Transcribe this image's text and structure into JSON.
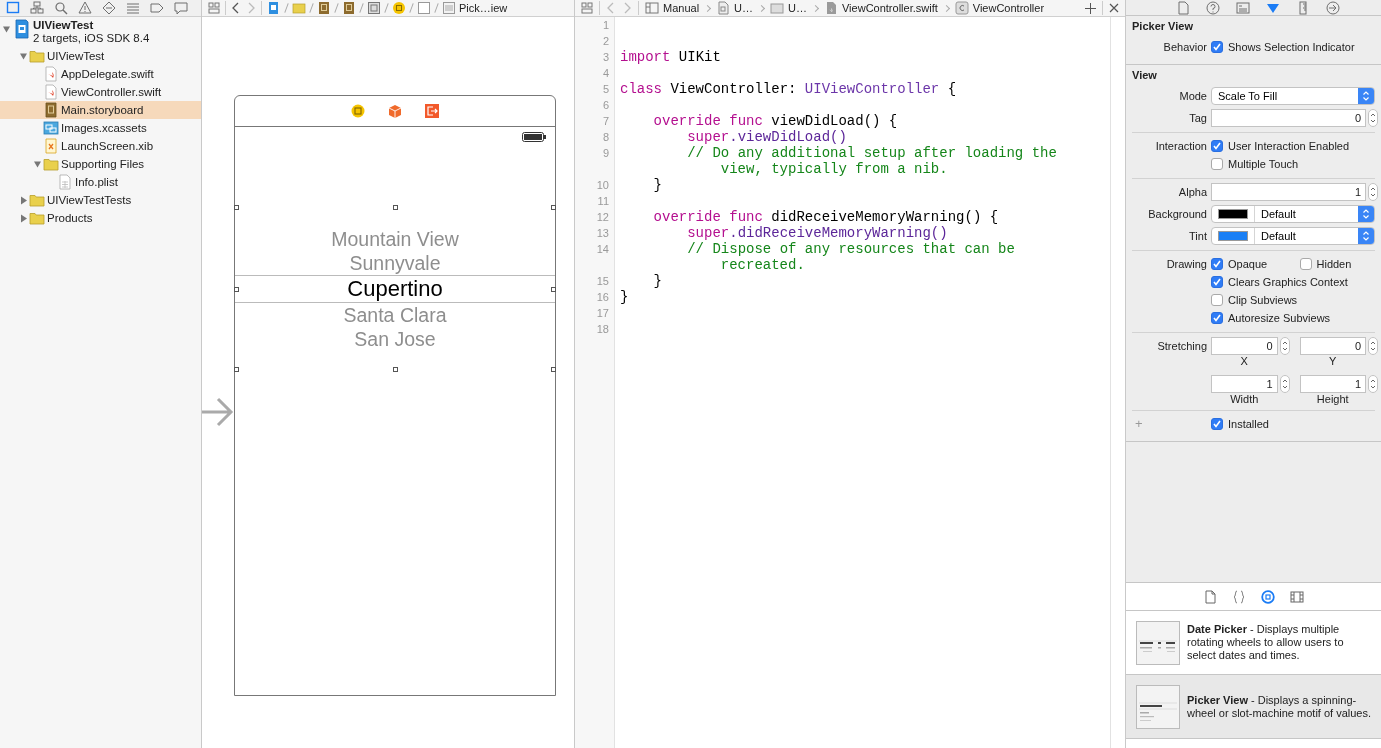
{
  "navigator": {
    "tabs": [
      {
        "kind": "folder",
        "selected": true
      },
      {
        "kind": "hierarchy",
        "selected": false
      },
      {
        "kind": "search",
        "selected": false
      },
      {
        "kind": "warning",
        "selected": false
      },
      {
        "kind": "test",
        "selected": false
      },
      {
        "kind": "debug",
        "selected": false
      },
      {
        "kind": "breakpoint",
        "selected": false
      },
      {
        "kind": "report",
        "selected": false
      }
    ],
    "project": {
      "name": "UIViewTest",
      "subtitle": "2 targets, iOS SDK 8.4",
      "expanded": true,
      "children": [
        {
          "name": "UIViewTest",
          "kind": "folder",
          "expanded": true,
          "selected": false,
          "children": [
            {
              "name": "AppDelegate.swift",
              "kind": "swift",
              "selected": false
            },
            {
              "name": "ViewController.swift",
              "kind": "swift",
              "selected": false
            },
            {
              "name": "Main.storyboard",
              "kind": "storyboard",
              "selected": true
            },
            {
              "name": "Images.xcassets",
              "kind": "assets",
              "selected": false
            },
            {
              "name": "LaunchScreen.xib",
              "kind": "xib",
              "selected": false
            },
            {
              "name": "Supporting Files",
              "kind": "folder",
              "expanded": true,
              "selected": false,
              "children": [
                {
                  "name": "Info.plist",
                  "kind": "plist",
                  "selected": false
                }
              ]
            }
          ]
        },
        {
          "name": "UIViewTestTests",
          "kind": "folder",
          "expanded": false,
          "selected": false
        },
        {
          "name": "Products",
          "kind": "folder",
          "expanded": false,
          "selected": false
        }
      ]
    }
  },
  "canvas": {
    "jump_bar": {
      "crumbs": [
        {
          "kind": "project"
        },
        {
          "kind": "folder"
        },
        {
          "kind": "storyboard"
        },
        {
          "kind": "storyboard"
        },
        {
          "kind": "scene"
        },
        {
          "kind": "controller"
        },
        {
          "kind": "view"
        },
        {
          "kind": "picker",
          "label": "Pick…iew"
        }
      ]
    },
    "scene": {
      "bar_icons": [
        {
          "kind": "controller"
        },
        {
          "kind": "cube"
        },
        {
          "kind": "exit"
        }
      ],
      "picker": {
        "items": [
          {
            "text": "Mountain View",
            "selected": false
          },
          {
            "text": "Sunnyvale",
            "selected": false
          },
          {
            "text": "Cupertino",
            "selected": true
          },
          {
            "text": "Santa Clara",
            "selected": false
          },
          {
            "text": "San Jose",
            "selected": false
          }
        ]
      }
    }
  },
  "editor": {
    "jump_bar": {
      "crumbs": [
        {
          "kind": "related",
          "label": "Manual"
        },
        {
          "kind": "doc",
          "label": "U…"
        },
        {
          "kind": "folder",
          "label": "U…"
        },
        {
          "kind": "swift",
          "label": "ViewController.swift"
        },
        {
          "kind": "class",
          "label": "ViewController"
        }
      ]
    },
    "lines": [
      {
        "number": "1"
      },
      {
        "number": "2"
      },
      {
        "number": "3",
        "tokens": [
          {
            "kind": "keyword",
            "text": "import"
          },
          {
            "kind": "plain",
            "text": " UIKit"
          }
        ]
      },
      {
        "number": "4"
      },
      {
        "number": "5",
        "tokens": [
          {
            "kind": "keyword",
            "text": "class"
          },
          {
            "kind": "plain",
            "text": " ViewController: "
          },
          {
            "kind": "type",
            "text": "UIViewController"
          },
          {
            "kind": "plain",
            "text": " {"
          }
        ]
      },
      {
        "number": "6"
      },
      {
        "number": "7",
        "tokens": [
          {
            "kind": "keyword",
            "text": "    override"
          },
          {
            "kind": "keyword",
            "text": " func"
          },
          {
            "kind": "plain",
            "text": " viewDidLoad() {"
          }
        ]
      },
      {
        "number": "8",
        "tokens": [
          {
            "kind": "keyword",
            "text": "        super"
          },
          {
            "kind": "method",
            "text": ".viewDidLoad()"
          }
        ]
      },
      {
        "number": "9",
        "tokens": [
          {
            "kind": "comment",
            "text": "        // Do any additional setup after loading the view, typically from a nib."
          }
        ]
      },
      {
        "number": "10",
        "tokens": [
          {
            "kind": "plain",
            "text": "    }"
          }
        ]
      },
      {
        "number": "11"
      },
      {
        "number": "12",
        "tokens": [
          {
            "kind": "keyword",
            "text": "    override"
          },
          {
            "kind": "keyword",
            "text": " func"
          },
          {
            "kind": "plain",
            "text": " didReceiveMemoryWarning() {"
          }
        ]
      },
      {
        "number": "13",
        "tokens": [
          {
            "kind": "keyword",
            "text": "        super"
          },
          {
            "kind": "method",
            "text": ".didReceiveMemoryWarning()"
          }
        ]
      },
      {
        "number": "14",
        "tokens": [
          {
            "kind": "comment",
            "text": "        // Dispose of any resources that can be recreated."
          }
        ]
      },
      {
        "number": "15",
        "tokens": [
          {
            "kind": "plain",
            "text": "    }"
          }
        ]
      },
      {
        "number": "16",
        "tokens": [
          {
            "kind": "plain",
            "text": "}"
          }
        ]
      },
      {
        "number": "17"
      },
      {
        "number": "18"
      }
    ]
  },
  "inspector": {
    "tabs": [
      {
        "kind": "file",
        "selected": false
      },
      {
        "kind": "help",
        "selected": false
      },
      {
        "kind": "identity",
        "selected": false
      },
      {
        "kind": "attributes",
        "selected": true
      },
      {
        "kind": "size",
        "selected": false
      },
      {
        "kind": "connections",
        "selected": false
      }
    ],
    "sections": [
      {
        "title": "Picker View",
        "groups": [
          [
            {
              "kind": "checks",
              "label": "Behavior",
              "lines": [
                [
                  {
                    "text": "Shows Selection Indicator",
                    "checked": true
                  }
                ]
              ]
            }
          ]
        ]
      },
      {
        "title": "View",
        "groups": [
          [
            {
              "kind": "select",
              "label": "Mode",
              "value": "Scale To Fill"
            },
            {
              "kind": "number",
              "label": "Tag",
              "value": "0"
            }
          ],
          [
            {
              "kind": "checks",
              "label": "Interaction",
              "lines": [
                [
                  {
                    "text": "User Interaction Enabled",
                    "checked": true
                  }
                ],
                [
                  {
                    "text": "Multiple Touch",
                    "checked": false
                  }
                ]
              ]
            }
          ],
          [
            {
              "kind": "number",
              "label": "Alpha",
              "value": "1"
            },
            {
              "kind": "color",
              "label": "Background",
              "color": "#000000",
              "value": "Default"
            },
            {
              "kind": "color",
              "label": "Tint",
              "color": "#1a7ff5",
              "value": "Default"
            }
          ],
          [
            {
              "kind": "checks",
              "label": "Drawing",
              "lines": [
                [
                  {
                    "text": "Opaque",
                    "checked": true
                  },
                  {
                    "text": "Hidden",
                    "checked": false
                  }
                ],
                [
                  {
                    "text": "Clears Graphics Context",
                    "checked": true
                  }
                ],
                [
                  {
                    "text": "Clip Subviews",
                    "checked": false
                  }
                ],
                [
                  {
                    "text": "Autoresize Subviews",
                    "checked": true
                  }
                ]
              ]
            }
          ],
          [
            {
              "kind": "pairs",
              "label": "Stretching",
              "fields": [
                {
                  "value": "0",
                  "caption": "X"
                },
                {
                  "value": "0",
                  "caption": "Y"
                },
                {
                  "value": "1",
                  "caption": "Width"
                },
                {
                  "value": "1",
                  "caption": "Height"
                }
              ]
            }
          ],
          [
            {
              "kind": "checks",
              "button": "+",
              "lines": [
                [
                  {
                    "text": "Installed",
                    "checked": true
                  }
                ]
              ]
            }
          ]
        ]
      }
    ]
  },
  "library": {
    "tabs": [
      {
        "kind": "file",
        "selected": false
      },
      {
        "kind": "braces",
        "selected": false
      },
      {
        "kind": "object",
        "selected": true
      },
      {
        "kind": "media",
        "selected": false
      }
    ],
    "items": [
      {
        "kind": "date-picker",
        "description": "**Date Picker** - Displays multiple rotating wheels to allow users to select dates and times.",
        "selected": false
      },
      {
        "kind": "picker-view",
        "description": "**Picker View** - Displays a spinning-wheel or slot-machine motif of values.",
        "selected": true
      }
    ]
  }
}
